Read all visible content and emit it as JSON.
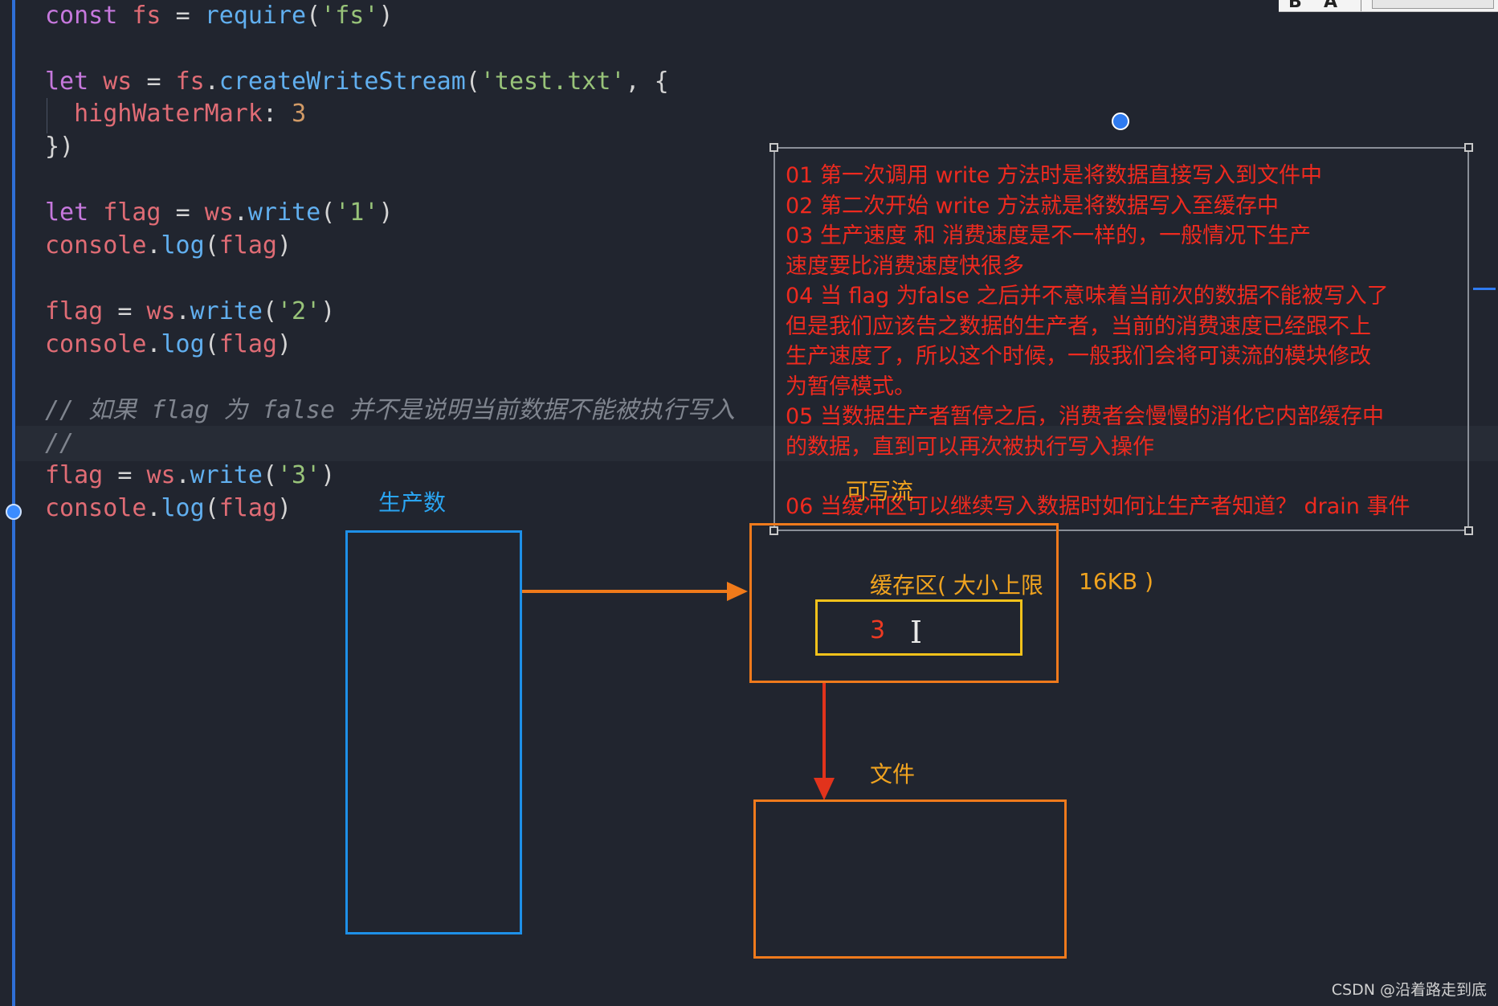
{
  "editor": {
    "code_lines": [
      [
        {
          "t": "const",
          "c": "kw"
        },
        {
          "t": " fs ",
          "c": "var"
        },
        {
          "t": "= ",
          "c": "plain"
        },
        {
          "t": "require",
          "c": "fn"
        },
        {
          "t": "(",
          "c": "plain"
        },
        {
          "t": "'fs'",
          "c": "str"
        },
        {
          "t": ")",
          "c": "plain"
        }
      ],
      [],
      [
        {
          "t": "let",
          "c": "kw"
        },
        {
          "t": " ws ",
          "c": "var"
        },
        {
          "t": "= ",
          "c": "plain"
        },
        {
          "t": "fs",
          "c": "var"
        },
        {
          "t": ".",
          "c": "plain"
        },
        {
          "t": "createWriteStream",
          "c": "fn"
        },
        {
          "t": "(",
          "c": "plain"
        },
        {
          "t": "'test.txt'",
          "c": "str"
        },
        {
          "t": ", {",
          "c": "plain"
        }
      ],
      [
        {
          "t": "  highWaterMark",
          "c": "var"
        },
        {
          "t": ": ",
          "c": "plain"
        },
        {
          "t": "3",
          "c": "num"
        }
      ],
      [
        {
          "t": "})",
          "c": "plain"
        }
      ],
      [],
      [
        {
          "t": "let",
          "c": "kw"
        },
        {
          "t": " flag ",
          "c": "var"
        },
        {
          "t": "= ",
          "c": "plain"
        },
        {
          "t": "ws",
          "c": "var"
        },
        {
          "t": ".",
          "c": "plain"
        },
        {
          "t": "write",
          "c": "fn"
        },
        {
          "t": "(",
          "c": "plain"
        },
        {
          "t": "'1'",
          "c": "str"
        },
        {
          "t": ")",
          "c": "plain"
        }
      ],
      [
        {
          "t": "console",
          "c": "var"
        },
        {
          "t": ".",
          "c": "plain"
        },
        {
          "t": "log",
          "c": "fn"
        },
        {
          "t": "(",
          "c": "plain"
        },
        {
          "t": "flag",
          "c": "var"
        },
        {
          "t": ")",
          "c": "plain"
        }
      ],
      [],
      [
        {
          "t": "flag ",
          "c": "var"
        },
        {
          "t": "= ",
          "c": "plain"
        },
        {
          "t": "ws",
          "c": "var"
        },
        {
          "t": ".",
          "c": "plain"
        },
        {
          "t": "write",
          "c": "fn"
        },
        {
          "t": "(",
          "c": "plain"
        },
        {
          "t": "'2'",
          "c": "str"
        },
        {
          "t": ")",
          "c": "plain"
        }
      ],
      [
        {
          "t": "console",
          "c": "var"
        },
        {
          "t": ".",
          "c": "plain"
        },
        {
          "t": "log",
          "c": "fn"
        },
        {
          "t": "(",
          "c": "plain"
        },
        {
          "t": "flag",
          "c": "var"
        },
        {
          "t": ")",
          "c": "plain"
        }
      ],
      [],
      [
        {
          "t": "// 如果 flag 为 false 并不是说明当前数据不能被执行写入",
          "c": "cmt"
        }
      ],
      [
        {
          "t": "//",
          "c": "cmt"
        }
      ],
      [
        {
          "t": "flag ",
          "c": "var"
        },
        {
          "t": "= ",
          "c": "plain"
        },
        {
          "t": "ws",
          "c": "var"
        },
        {
          "t": ".",
          "c": "plain"
        },
        {
          "t": "write",
          "c": "fn"
        },
        {
          "t": "(",
          "c": "plain"
        },
        {
          "t": "'3'",
          "c": "str"
        },
        {
          "t": ")",
          "c": "plain"
        }
      ],
      [
        {
          "t": "console",
          "c": "var"
        },
        {
          "t": ".",
          "c": "plain"
        },
        {
          "t": "log",
          "c": "fn"
        },
        {
          "t": "(",
          "c": "plain"
        },
        {
          "t": "flag",
          "c": "var"
        },
        {
          "t": ")",
          "c": "plain"
        }
      ]
    ]
  },
  "toolbar": {
    "glyph_1": "B",
    "glyph_2": "A"
  },
  "notes": [
    "01 第一次调用 write 方法时是将数据直接写入到文件中",
    "02 第二次开始 write 方法就是将数据写入至缓存中",
    "03 生产速度 和 消费速度是不一样的，一般情况下生产",
    "速度要比消费速度快很多",
    "04 当 flag 为false 之后并不意味着当前次的数据不能被写入了",
    "但是我们应该告之数据的生产者，当前的消费速度已经跟不上",
    "生产速度了，所以这个时候，一般我们会将可读流的模块修改",
    "为暂停模式。",
    "05 当数据生产者暂停之后，消费者会慢慢的消化它内部缓存中",
    "的数据，直到可以再次被执行写入操作",
    "06 当缓冲区可以继续写入数据时如何让生产者知道？ drain 事件"
  ],
  "diagram": {
    "producer_label": "生产数",
    "writable_label": "可写流",
    "buffer_label": "缓存区( 大小上限",
    "buffer_limit": "16KB )",
    "buffer_value": "3",
    "file_label": "文件",
    "colors": {
      "producer": "#1e90e8",
      "buffer": "#ef7a1c",
      "inner": "#f3c21b",
      "arrow_to_file": "#e2331c",
      "note_text": "#ee2a1f"
    }
  },
  "watermark": "CSDN @沿着路走到底",
  "cursor_glyph": "I"
}
